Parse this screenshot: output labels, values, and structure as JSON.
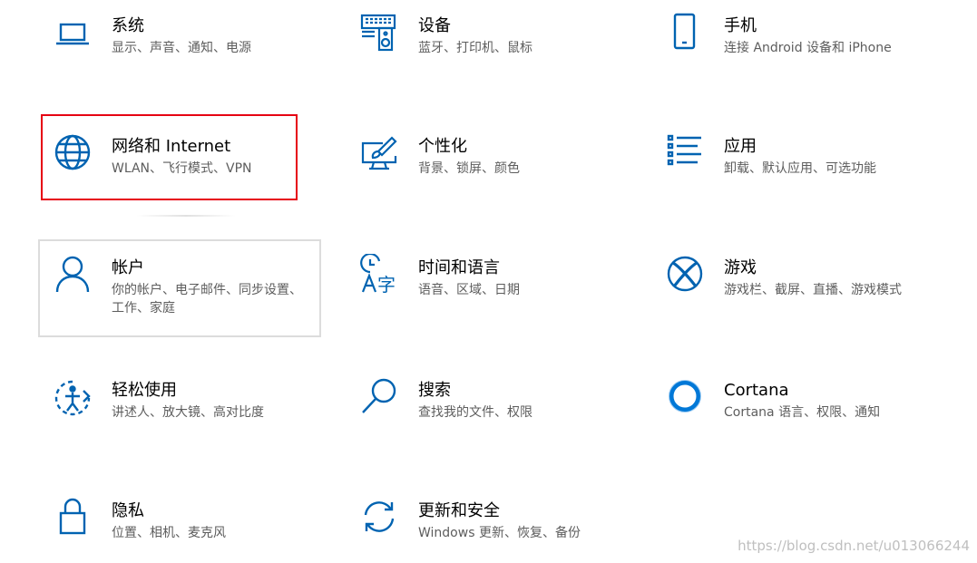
{
  "tiles": [
    {
      "id": "system",
      "title": "系统",
      "desc": "显示、声音、通知、电源",
      "icon": "laptop-icon"
    },
    {
      "id": "devices",
      "title": "设备",
      "desc": "蓝牙、打印机、鼠标",
      "icon": "keyboard-speaker-icon"
    },
    {
      "id": "phone",
      "title": "手机",
      "desc": "连接 Android 设备和 iPhone",
      "icon": "phone-icon"
    },
    {
      "id": "network",
      "title": "网络和 Internet",
      "desc": "WLAN、飞行模式、VPN",
      "icon": "globe-icon"
    },
    {
      "id": "personalization",
      "title": "个性化",
      "desc": "背景、锁屏、颜色",
      "icon": "paint-monitor-icon"
    },
    {
      "id": "apps",
      "title": "应用",
      "desc": "卸载、默认应用、可选功能",
      "icon": "app-list-icon"
    },
    {
      "id": "accounts",
      "title": "帐户",
      "desc": "你的帐户、电子邮件、同步设置、工作、家庭",
      "icon": "person-icon"
    },
    {
      "id": "time-language",
      "title": "时间和语言",
      "desc": "语音、区域、日期",
      "icon": "time-language-icon"
    },
    {
      "id": "gaming",
      "title": "游戏",
      "desc": "游戏栏、截屏、直播、游戏模式",
      "icon": "xbox-icon"
    },
    {
      "id": "ease-of-access",
      "title": "轻松使用",
      "desc": "讲述人、放大镜、高对比度",
      "icon": "ease-of-access-icon"
    },
    {
      "id": "search",
      "title": "搜索",
      "desc": "查找我的文件、权限",
      "icon": "search-icon"
    },
    {
      "id": "cortana",
      "title": "Cortana",
      "desc": "Cortana 语言、权限、通知",
      "icon": "cortana-icon"
    },
    {
      "id": "privacy",
      "title": "隐私",
      "desc": "位置、相机、麦克风",
      "icon": "lock-icon"
    },
    {
      "id": "update-security",
      "title": "更新和安全",
      "desc": "Windows 更新、恢复、备份",
      "icon": "refresh-icon"
    }
  ],
  "watermark": "https://blog.csdn.net/u013066244",
  "colors": {
    "accent": "#0063b1",
    "highlight_border": "#e60012",
    "hover_border": "#dcdcdc"
  }
}
